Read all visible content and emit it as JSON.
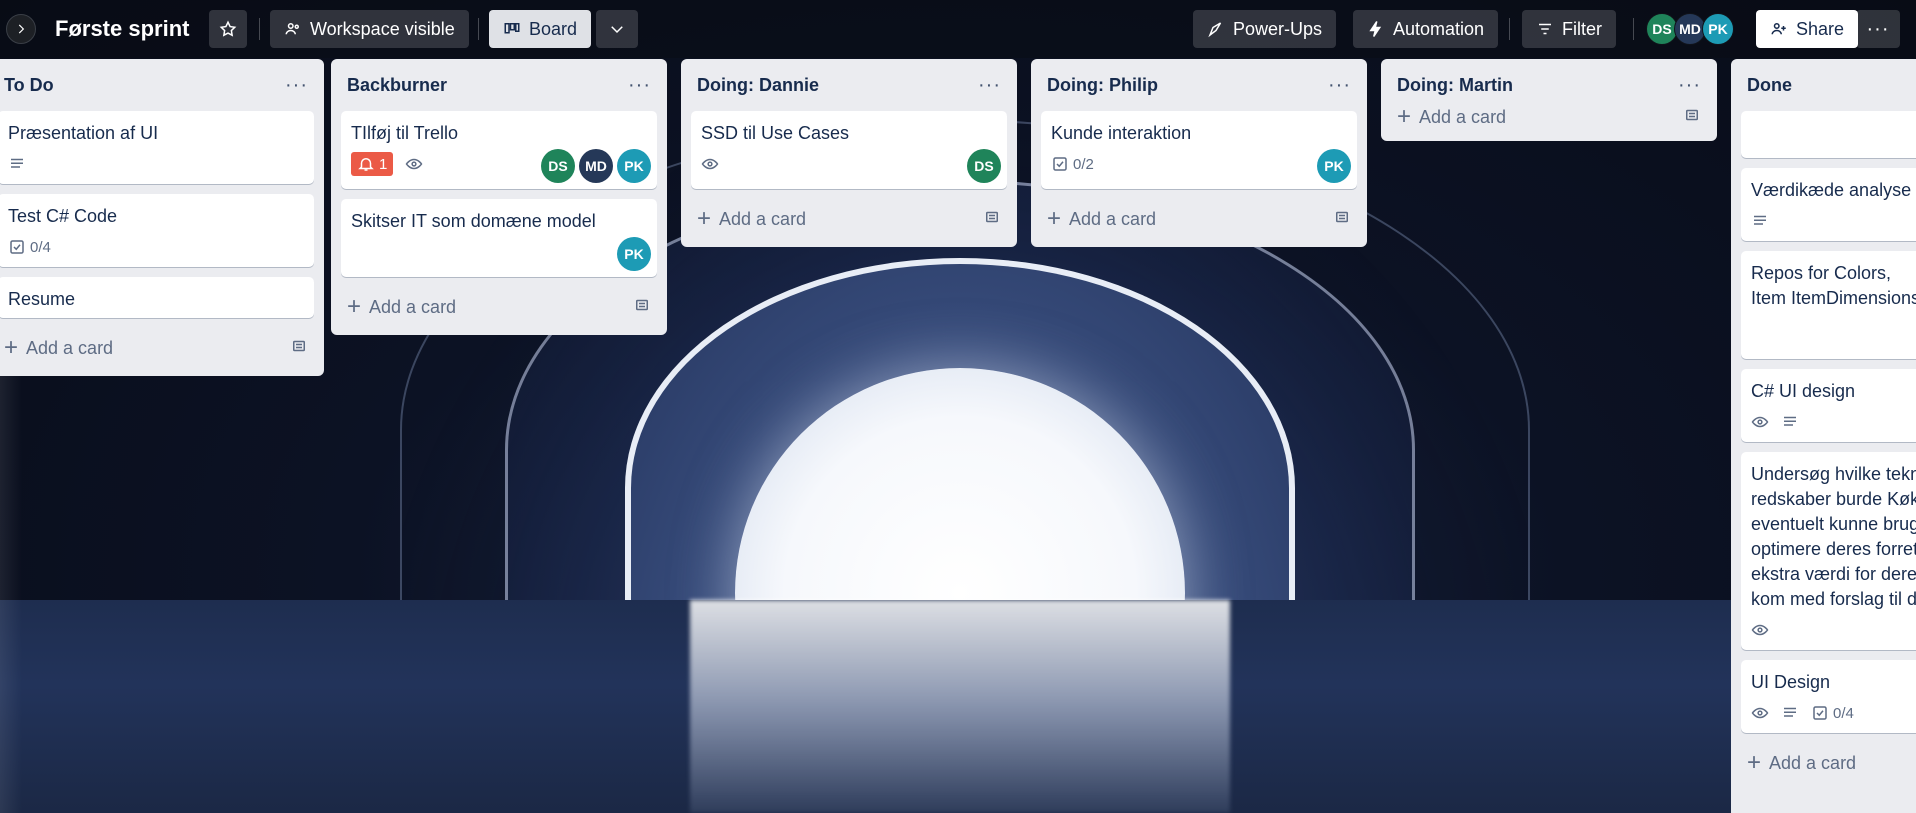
{
  "header": {
    "board_title": "Første sprint",
    "visibility_label": "Workspace visible",
    "board_view_label": "Board",
    "powerups_label": "Power-Ups",
    "automation_label": "Automation",
    "filter_label": "Filter",
    "share_label": "Share",
    "members": [
      {
        "initials": "DS",
        "color": "#1f845a"
      },
      {
        "initials": "MD",
        "color": "#253858"
      },
      {
        "initials": "PK",
        "color": "#1d9bb5"
      }
    ]
  },
  "lists": {
    "todo": {
      "title": "To Do",
      "add_label": "Add a card",
      "cards": [
        {
          "title": "Præsentation af UI"
        },
        {
          "title": "Test C# Code",
          "checklist": "0/4"
        },
        {
          "title": "Resume"
        }
      ]
    },
    "backburner": {
      "title": "Backburner",
      "add_label": "Add a card",
      "cards": [
        {
          "title": "TIlføj til Trello",
          "notifications": "1"
        },
        {
          "title": "Skitser IT som domæne model"
        }
      ]
    },
    "dannie": {
      "title": "Doing: Dannie",
      "add_label": "Add a card",
      "cards": [
        {
          "title": "SSD til Use Cases"
        }
      ]
    },
    "philip": {
      "title": "Doing: Philip",
      "add_label": "Add a card",
      "cards": [
        {
          "title": "Kunde interaktion",
          "checklist": "0/2"
        }
      ]
    },
    "martin": {
      "title": "Doing: Martin",
      "add_label": "Add a card"
    },
    "done": {
      "title": "Done",
      "add_label": "Add a card",
      "cards": [
        {
          "title": ""
        },
        {
          "title": "Værdikæde analyse"
        },
        {
          "title": "Repos for Colors, Item ItemDimensions"
        },
        {
          "title": "C# UI design"
        },
        {
          "title": "Undersøg hvilke tekno redskaber burde Køkk eventuelt kunne brug optimere deres forret ekstra værdi for deres kom med forslag til d"
        },
        {
          "title": "UI Design",
          "checklist": "0/4"
        }
      ]
    }
  }
}
